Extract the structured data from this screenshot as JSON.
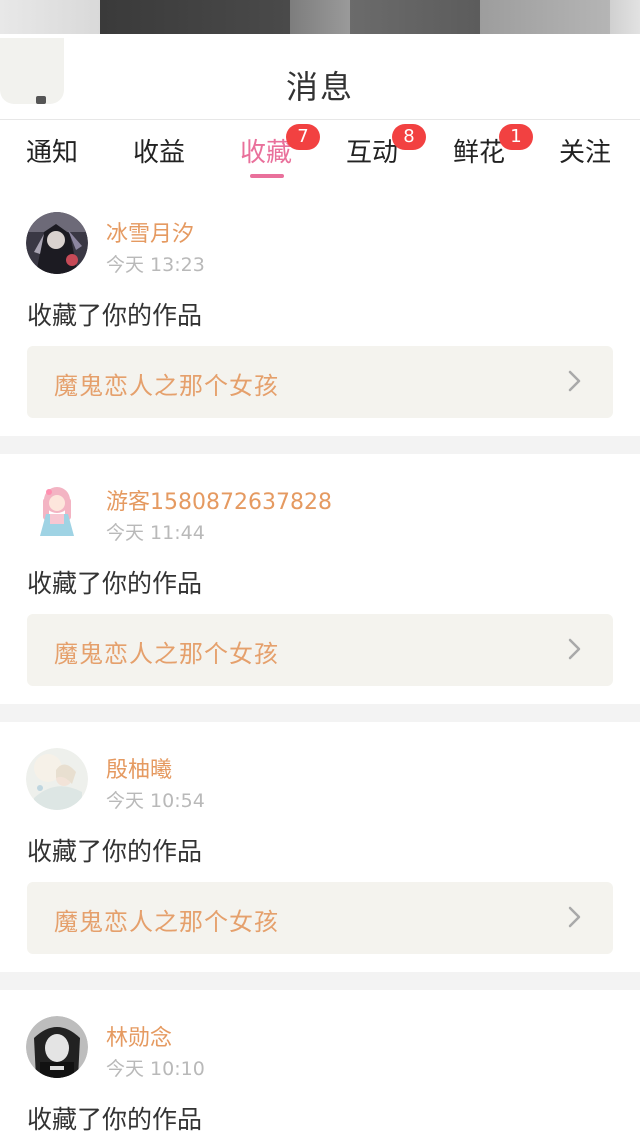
{
  "header": {
    "title": "消息"
  },
  "tabs": [
    {
      "label": "通知",
      "badge": ""
    },
    {
      "label": "收益",
      "badge": ""
    },
    {
      "label": "收藏",
      "badge": "7",
      "active": true
    },
    {
      "label": "互动",
      "badge": "8"
    },
    {
      "label": "鲜花",
      "badge": "1"
    },
    {
      "label": "关注",
      "badge": ""
    }
  ],
  "colors": {
    "accent": "#e9709b",
    "username": "#e59a61",
    "badge": "#f24141",
    "link_bg": "#f4f3ee"
  },
  "messages": [
    {
      "username": "冰雪月汐",
      "time": "今天 13:23",
      "action": "收藏了你的作品",
      "work_title": "魔鬼恋人之那个女孩",
      "avatar_icon": "avatar-dark-anime"
    },
    {
      "username": "游客1580872637828",
      "time": "今天 11:44",
      "action": "收藏了你的作品",
      "work_title": "魔鬼恋人之那个女孩",
      "avatar_icon": "avatar-pink-girl"
    },
    {
      "username": "殷柚曦",
      "time": "今天 10:54",
      "action": "收藏了你的作品",
      "work_title": "魔鬼恋人之那个女孩",
      "avatar_icon": "avatar-light-anime"
    },
    {
      "username": "林勋念",
      "time": "今天 10:10",
      "action": "收藏了你的作品",
      "work_title": "",
      "avatar_icon": "avatar-black-white-photo"
    }
  ]
}
